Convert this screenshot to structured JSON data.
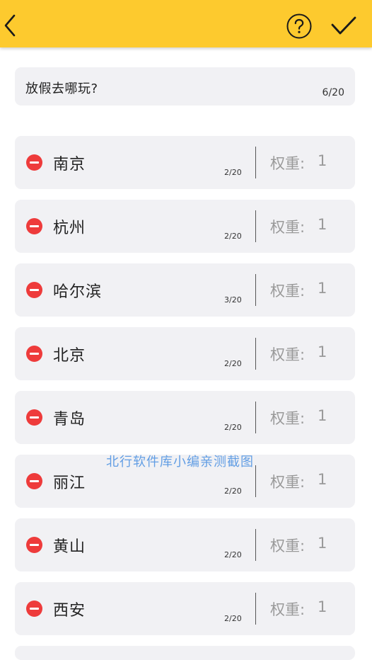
{
  "header": {
    "back_icon": "chevron-left-icon",
    "help_icon": "question-circle-icon",
    "confirm_icon": "checkmark-icon",
    "background_color": "#fdca2e"
  },
  "question": {
    "text": "放假去哪玩?",
    "char_count": "6/20"
  },
  "options": [
    {
      "name": "南京",
      "char_count": "2/20",
      "weight_label": "权重:",
      "weight_value": "1"
    },
    {
      "name": "杭州",
      "char_count": "2/20",
      "weight_label": "权重:",
      "weight_value": "1"
    },
    {
      "name": "哈尔滨",
      "char_count": "3/20",
      "weight_label": "权重:",
      "weight_value": "1"
    },
    {
      "name": "北京",
      "char_count": "2/20",
      "weight_label": "权重:",
      "weight_value": "1"
    },
    {
      "name": "青岛",
      "char_count": "2/20",
      "weight_label": "权重:",
      "weight_value": "1"
    },
    {
      "name": "丽江",
      "char_count": "2/20",
      "weight_label": "权重:",
      "weight_value": "1"
    },
    {
      "name": "黄山",
      "char_count": "2/20",
      "weight_label": "权重:",
      "weight_value": "1"
    },
    {
      "name": "西安",
      "char_count": "2/20",
      "weight_label": "权重:",
      "weight_value": "1"
    }
  ],
  "watermark": "北行软件库小编亲测截图",
  "colors": {
    "remove_button": "#ee3b3b",
    "row_background": "#f1f1f4",
    "weight_text": "#9a9a9a"
  }
}
